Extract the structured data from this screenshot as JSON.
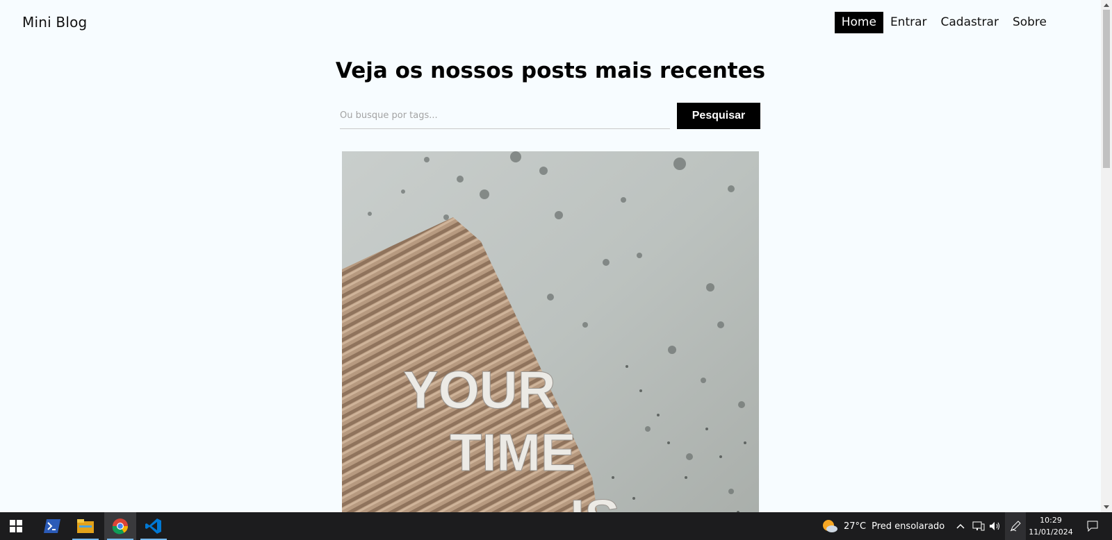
{
  "header": {
    "brand": "Mini Blog",
    "nav": [
      {
        "label": "Home",
        "active": true
      },
      {
        "label": "Entrar",
        "active": false
      },
      {
        "label": "Cadastrar",
        "active": false
      },
      {
        "label": "Sobre",
        "active": false
      }
    ]
  },
  "main": {
    "title": "Veja os nossos posts mais recentes",
    "search": {
      "placeholder": "Ou busque por tags...",
      "value": "",
      "button_label": "Pesquisar"
    },
    "post_image": {
      "text_lines": [
        "YOUR",
        "TIME",
        "IS"
      ]
    }
  },
  "taskbar": {
    "apps": [
      {
        "name": "windows-start-icon"
      },
      {
        "name": "powershell-icon"
      },
      {
        "name": "file-explorer-icon"
      },
      {
        "name": "chrome-icon"
      },
      {
        "name": "vscode-icon"
      }
    ],
    "weather": {
      "temperature": "27°C",
      "description": "Pred ensolarado"
    },
    "clock": {
      "time": "10:29",
      "date": "11/01/2024"
    }
  },
  "colors": {
    "page_background": "#f7fcff",
    "accent": "#000000",
    "taskbar": "#1c1c1e"
  }
}
